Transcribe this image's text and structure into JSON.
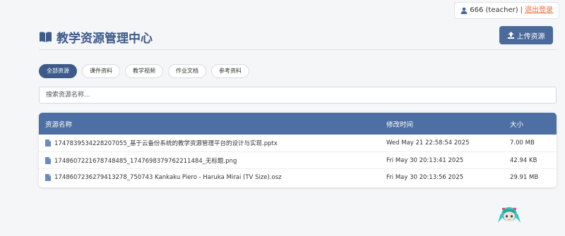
{
  "user_bar": {
    "user": "666 (teacher)",
    "separator": "|",
    "logout": "退出登录",
    "icon": "user-icon"
  },
  "header": {
    "title": "教学资源管理中心",
    "title_icon": "book-icon",
    "upload_label": "上传资源",
    "upload_icon": "upload-icon"
  },
  "tabs": [
    {
      "label": "全部资源",
      "active": true
    },
    {
      "label": "课件资料",
      "active": false
    },
    {
      "label": "教学视频",
      "active": false
    },
    {
      "label": "作业文档",
      "active": false
    },
    {
      "label": "参考资料",
      "active": false
    }
  ],
  "search": {
    "placeholder": "搜索资源名称...",
    "value": ""
  },
  "table": {
    "columns": [
      "资源名称",
      "修改时间",
      "大小"
    ],
    "rows": [
      {
        "name": "1747839534228207055_基于云备份系统的教学资源管理平台的设计与实现.pptx",
        "time": "Wed May 21 22:58:54 2025",
        "size": "7.00 MB"
      },
      {
        "name": "1748607221678748485_1747698379762211484_无标题.png",
        "time": "Fri May 30 20:13:41 2025",
        "size": "42.94 KB"
      },
      {
        "name": "1748607236279413278_750743 Kankaku Piero - Haruka Mirai (TV Size).osz",
        "time": "Fri May 30 20:13:56 2025",
        "size": "29.91 MB"
      }
    ]
  },
  "colors": {
    "accent": "#3d5a8a",
    "table_header": "#4d6fa3",
    "logout": "#e8733f"
  }
}
